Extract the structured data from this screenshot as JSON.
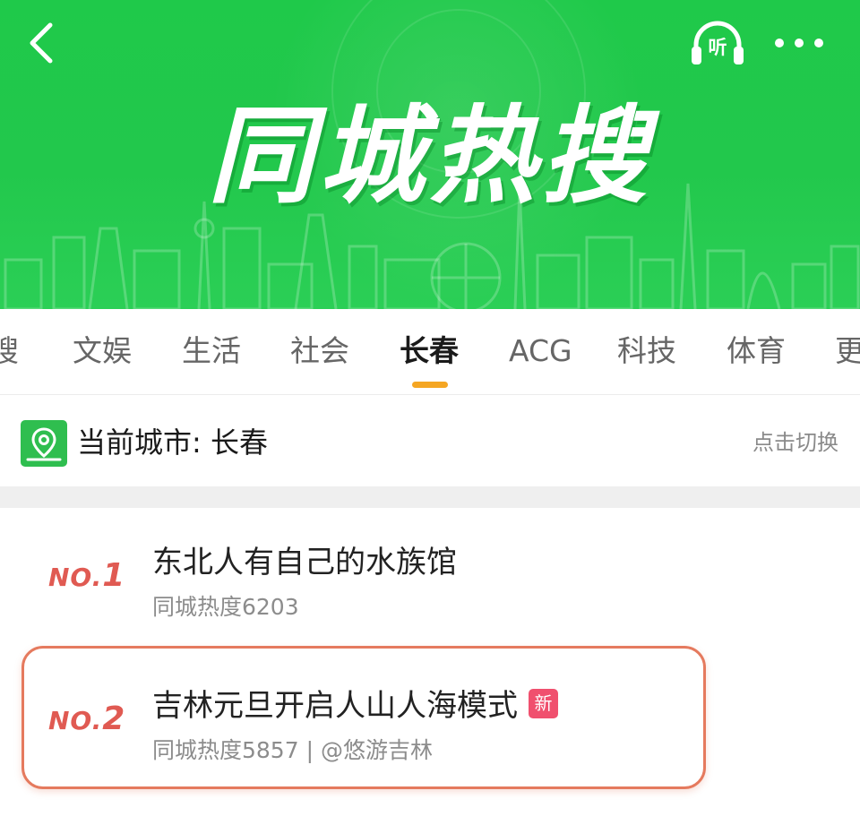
{
  "header": {
    "title": "同城热搜",
    "back_icon": "chevron-left-icon",
    "listen_icon": "headphones-icon",
    "listen_label": "听",
    "more_icon": "more-dots-icon",
    "accent_color": "#22c84c"
  },
  "tabs": {
    "items": [
      {
        "label": "搜"
      },
      {
        "label": "文娱"
      },
      {
        "label": "生活"
      },
      {
        "label": "社会"
      },
      {
        "label": "长春"
      },
      {
        "label": "ACG"
      },
      {
        "label": "科技"
      },
      {
        "label": "体育"
      },
      {
        "label": "更"
      }
    ],
    "active_index": 4,
    "indicator_color": "#f5a623"
  },
  "city_row": {
    "icon": "location-map-icon",
    "label": "当前城市: 长春",
    "switch_label": "点击切换"
  },
  "list": {
    "items": [
      {
        "rank_prefix": "NO.",
        "rank_number": "1",
        "title": "东北人有自己的水族馆",
        "meta": "同城热度6203"
      },
      {
        "rank_prefix": "NO.",
        "rank_number": "2",
        "title": "吉林元旦开启人山人海模式",
        "badge": "新",
        "meta": "同城热度5857 | @悠游吉林"
      }
    ],
    "rank_color": "#e05a52",
    "badge_color": "#f0506e",
    "highlight_color": "#e57a5e"
  }
}
